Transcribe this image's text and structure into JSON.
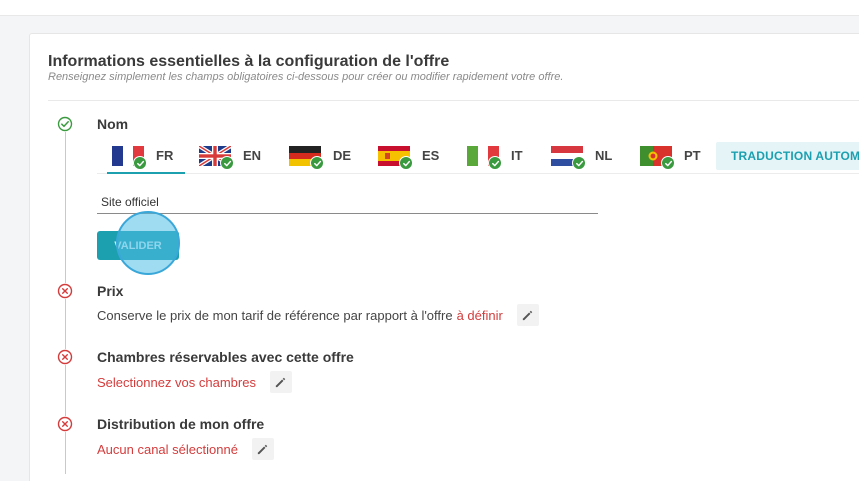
{
  "header": {
    "title": "Informations essentielles à la configuration de l'offre",
    "subtitle": "Renseignez simplement les champs obligatoires ci-dessous pour créer ou modifier rapidement votre offre."
  },
  "name_section": {
    "title": "Nom",
    "status": "complete",
    "languages": [
      {
        "code": "FR",
        "flag": "fr-flag-icon",
        "translated": true,
        "active": true
      },
      {
        "code": "EN",
        "flag": "uk-flag-icon",
        "translated": true,
        "active": false
      },
      {
        "code": "DE",
        "flag": "de-flag-icon",
        "translated": true,
        "active": false
      },
      {
        "code": "ES",
        "flag": "es-flag-icon",
        "translated": true,
        "active": false
      },
      {
        "code": "IT",
        "flag": "it-flag-icon",
        "translated": true,
        "active": false
      },
      {
        "code": "NL",
        "flag": "nl-flag-icon",
        "translated": true,
        "active": false
      },
      {
        "code": "PT",
        "flag": "pt-flag-icon",
        "translated": true,
        "active": false
      }
    ],
    "translate_label": "TRADUCTION AUTOM",
    "input_value": "Site officiel",
    "validate_label": "VALIDER"
  },
  "price_section": {
    "title": "Prix",
    "status": "incomplete",
    "text": "Conserve le prix de mon tarif de référence par rapport à l'offre",
    "highlight": "à définir"
  },
  "rooms_section": {
    "title": "Chambres réservables avec cette offre",
    "status": "incomplete",
    "text": "Selectionnez vos chambres"
  },
  "distribution_section": {
    "title": "Distribution de mon offre",
    "status": "incomplete",
    "text": "Aucun canal sélectionné"
  },
  "colors": {
    "accent": "#1ca0b0",
    "success": "#3a9a3f",
    "error": "#d43c3c"
  }
}
